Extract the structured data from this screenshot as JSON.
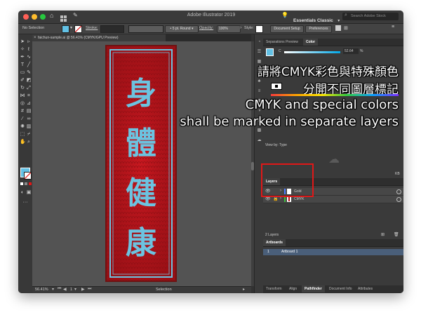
{
  "app": {
    "window_title": "Adobe Illustrator 2019",
    "workspace": "Essentials Classic",
    "search_placeholder": "Search Adobe Stock"
  },
  "control_bar": {
    "selection": "No Selection",
    "stroke_label": "Stroke:",
    "brush": "5 pt. Round",
    "opacity_label": "Opacity:",
    "opacity_value": "100%",
    "style_label": "Style:",
    "document_setup": "Document Setup",
    "preferences": "Preferences",
    "fill_color": "#62c1e5"
  },
  "document": {
    "tab_label": "faichun-sample.ai @ 56.41% (CMYK/GPU Preview)",
    "artboard_text": [
      "身",
      "體",
      "健",
      "康"
    ],
    "zoom": "56.41%",
    "artboard_number": "1",
    "status_tool": "Selection"
  },
  "panels": {
    "top_tabs": [
      "Separations Preview",
      "Color"
    ],
    "color_slider_label": "C",
    "color_value": "52.64",
    "color_unit": "%",
    "view_by": "View by: Type",
    "libraries_label": "KB",
    "layers_tab": "Layers",
    "layers": [
      {
        "name": "Gold",
        "color": "#4d7cff"
      },
      {
        "name": "CMYK",
        "color": "#3dbb3d"
      }
    ],
    "layers_count": "2 Layers",
    "artboards_tab": "Artboards",
    "artboards": [
      {
        "number": "1",
        "name": "Artboard 1"
      }
    ],
    "bottom_tabs": [
      "Transform",
      "Align",
      "Pathfinder",
      "Document Info",
      "Attributes"
    ]
  },
  "overlay": {
    "line1": "請將CMYK彩色與特殊顏色",
    "line2": "分開不同圖層標記",
    "line3": "CMYK and special colors",
    "line4": "shall be marked in separate layers"
  },
  "colors": {
    "artboard_red": "#b3131a",
    "calligraphy": "#6cc3e0",
    "highlight_red": "#e01818"
  }
}
